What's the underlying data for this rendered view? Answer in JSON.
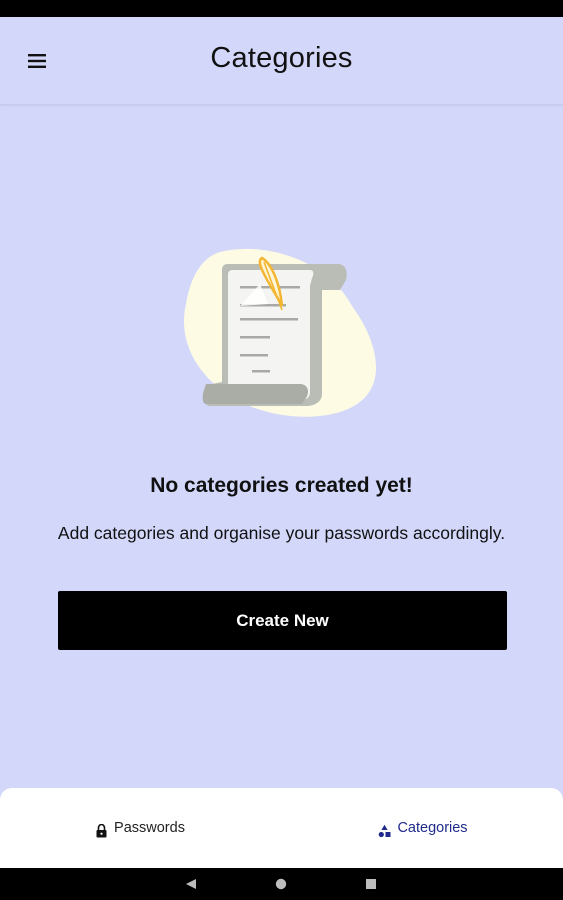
{
  "app_bar": {
    "title": "Categories",
    "menu_icon": "hamburger-menu-icon"
  },
  "empty_state": {
    "illustration": "scroll-document-quill-illustration",
    "title": "No categories created yet!",
    "subtitle": "Add categories and organise your passwords accordingly.",
    "button_label": "Create New"
  },
  "bottom_nav": {
    "tabs": [
      {
        "label": "Passwords",
        "icon": "lock-icon",
        "selected": false
      },
      {
        "label": "Categories",
        "icon": "categories-icon",
        "selected": true
      }
    ]
  },
  "system_nav": {
    "buttons": [
      "back-icon",
      "home-icon",
      "recents-icon"
    ]
  },
  "colors": {
    "background": "#d3d8fb",
    "button": "#000000",
    "nav_selected": "#1f2a8a",
    "illustration_blob": "#fdfbe3",
    "illustration_scroll": "#b9bdb5",
    "quill": "#f2b632"
  }
}
